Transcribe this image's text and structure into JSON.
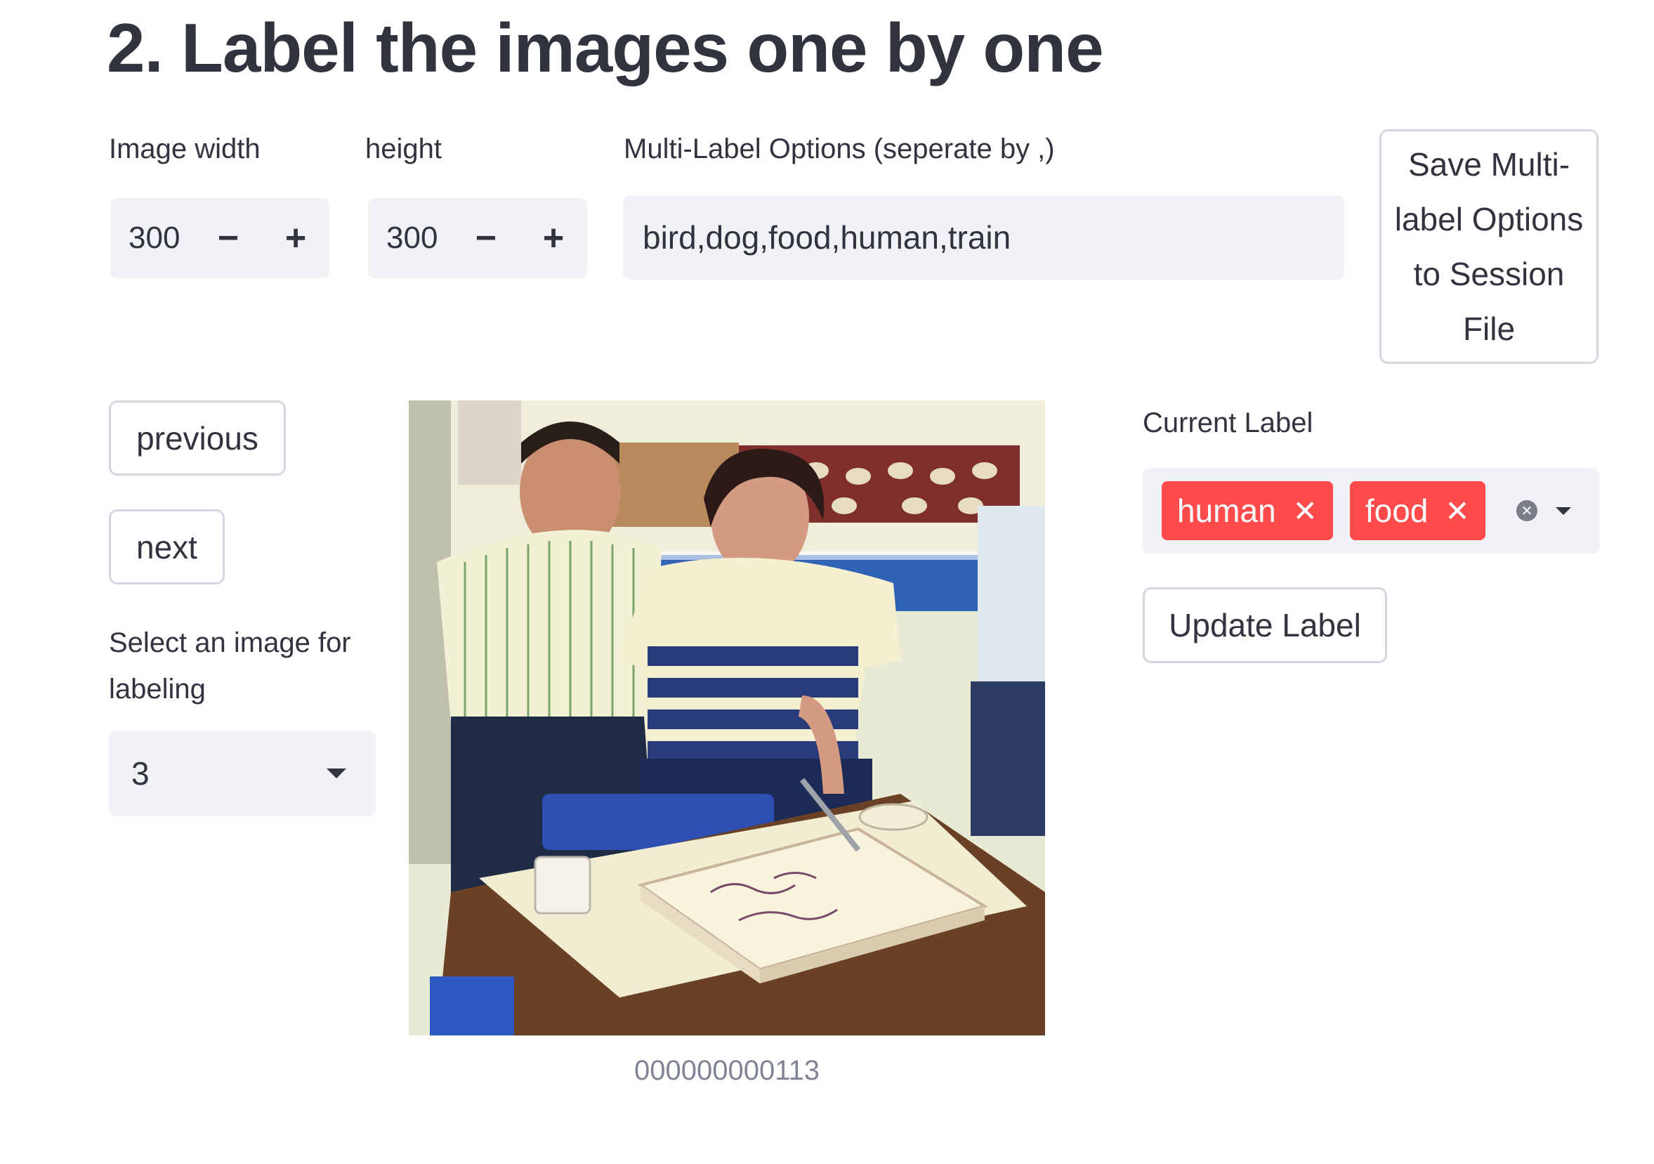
{
  "page": {
    "title": "2. Label the images one by one"
  },
  "image_width": {
    "label": "Image width",
    "value": "300",
    "minus": "−",
    "plus": "+"
  },
  "image_height": {
    "label": "height",
    "value": "300",
    "minus": "−",
    "plus": "+"
  },
  "multi_label_options": {
    "label": "Multi-Label Options (seperate by ,)",
    "value": "bird,dog,food,human,train"
  },
  "save_button": {
    "label": "Save Multi-label Options to Session File"
  },
  "navigation": {
    "previous_label": "previous",
    "next_label": "next"
  },
  "image_select": {
    "label": "Select an image for labeling",
    "value": "3"
  },
  "image": {
    "caption": "000000000113"
  },
  "current_label": {
    "label": "Current Label",
    "tags": [
      {
        "text": "human"
      },
      {
        "text": "food"
      }
    ],
    "tag_remove_glyph": "✕",
    "clear_glyph": "✕"
  },
  "update_button": {
    "label": "Update Label"
  },
  "colors": {
    "accent_tag": "#ff4b4b",
    "input_bg": "#f0f2f6",
    "text": "#31333f",
    "caption": "#808495"
  }
}
